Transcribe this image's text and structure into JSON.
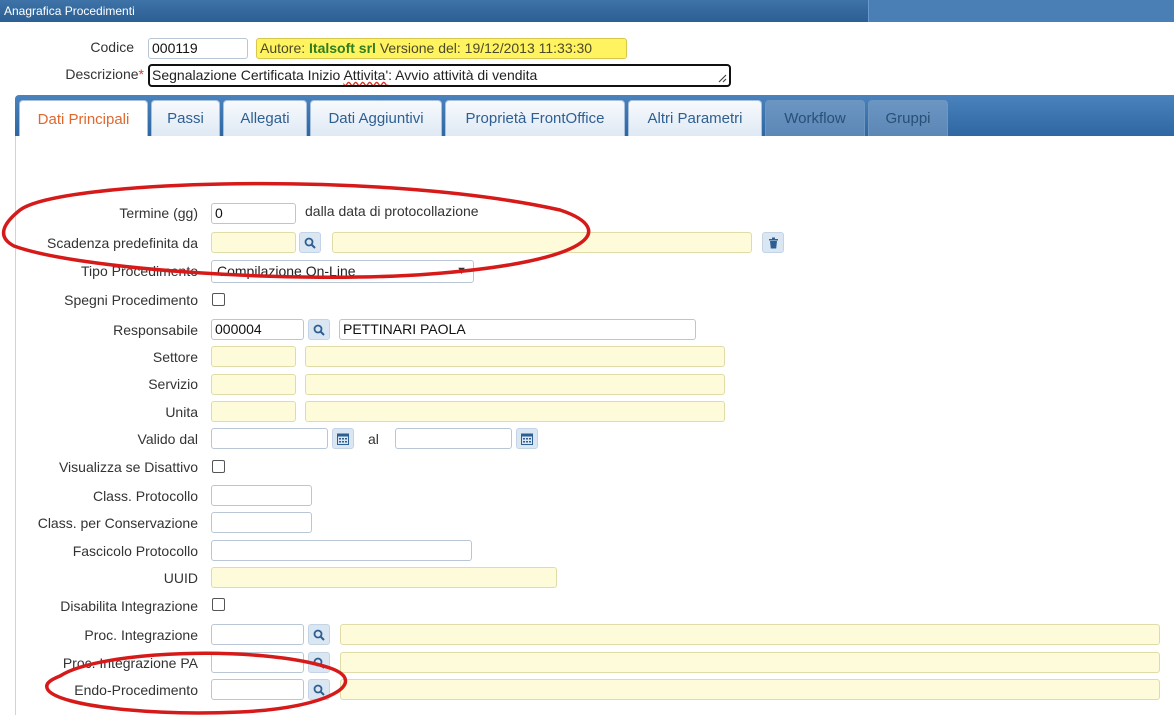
{
  "window": {
    "title": "Anagrafica Procedimenti"
  },
  "header": {
    "codice_label": "Codice",
    "codice_value": "000119",
    "info_prefix": "Autore: ",
    "info_author": "Italsoft srl",
    "info_suffix": " Versione del: 19/12/2013 11:33:30",
    "descrizione_label": "Descrizione",
    "descrizione_req": "*",
    "descrizione_pre": "Segnalazione Certificata Inizio ",
    "descrizione_mid": "Attivita'",
    "descrizione_post": ": Avvio attività di vendita"
  },
  "tabs": [
    {
      "label": "Dati Principali"
    },
    {
      "label": "Passi"
    },
    {
      "label": "Allegati"
    },
    {
      "label": "Dati Aggiuntivi"
    },
    {
      "label": "Proprietà FrontOffice"
    },
    {
      "label": "Altri Parametri"
    },
    {
      "label": "Workflow"
    },
    {
      "label": "Gruppi"
    }
  ],
  "form": {
    "termine_label": "Termine (gg)",
    "termine_value": "0",
    "termine_suffix": "dalla data di protocollazione",
    "scadenza_label": "Scadenza predefinita da",
    "tipo_label": "Tipo Procedimento",
    "tipo_value": "Compilazione On-Line",
    "spegni_label": "Spegni Procedimento",
    "responsabile_label": "Responsabile",
    "responsabile_code": "000004",
    "responsabile_name": "PETTINARI PAOLA",
    "settore_label": "Settore",
    "servizio_label": "Servizio",
    "unita_label": "Unita",
    "valido_label": "Valido dal",
    "al_label": "al",
    "visualizza_label": "Visualizza se Disattivo",
    "class_prot_label": "Class. Protocollo",
    "class_cons_label": "Class. per Conservazione",
    "fascicolo_label": "Fascicolo Protocollo",
    "uuid_label": "UUID",
    "disabilita_label": "Disabilita Integrazione",
    "proc_int_label": "Proc. Integrazione",
    "proc_int_pa_label": "Proc. Integrazione PA",
    "endo_label": "Endo-Procedimento"
  },
  "icons": {
    "search": "magnifier-icon",
    "trash": "trash-icon",
    "calendar": "calendar-icon"
  },
  "colors": {
    "accent_tab": "#e2672d",
    "required": "#d23a2d",
    "annotation": "#d61a1a",
    "field_yellow": "#fdfbd9"
  }
}
